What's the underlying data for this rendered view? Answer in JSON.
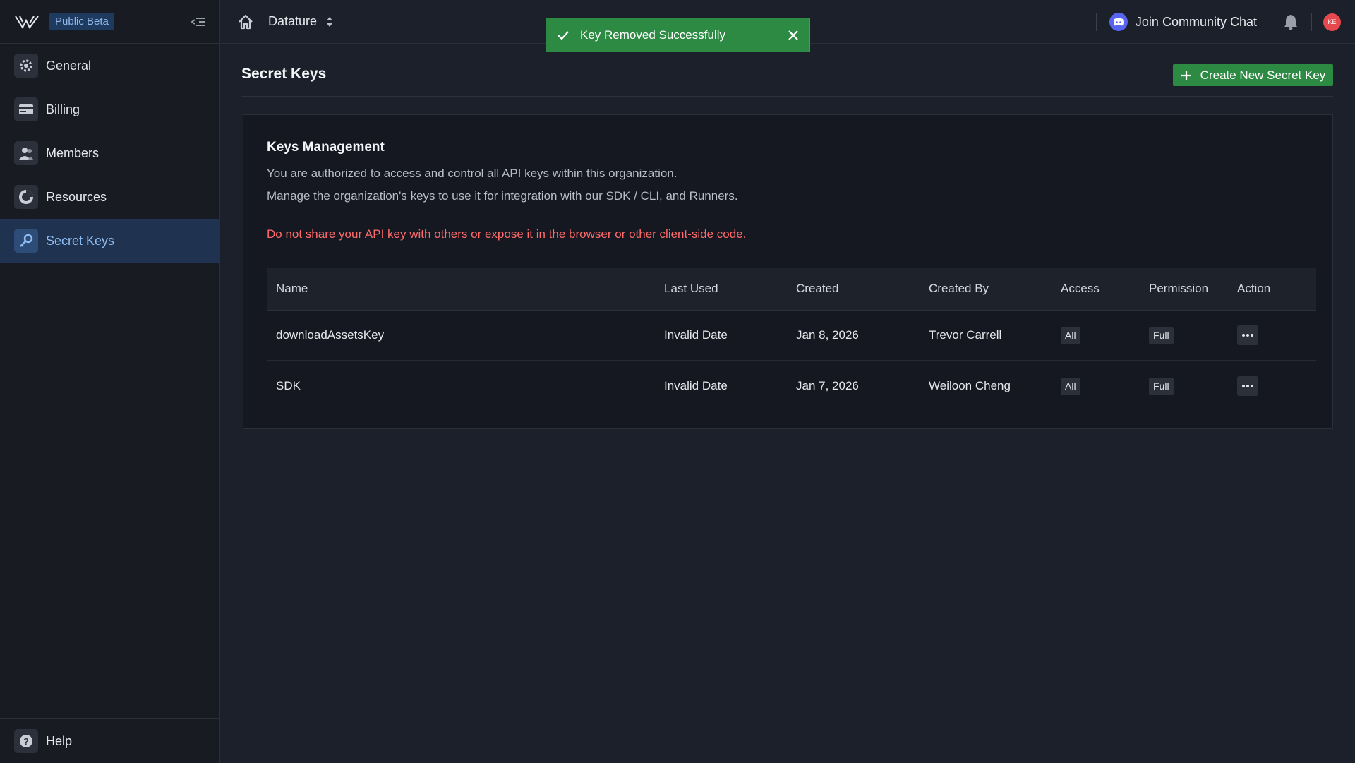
{
  "sidebar": {
    "badge": "Public Beta",
    "items": [
      {
        "label": "General",
        "icon": "gear-icon"
      },
      {
        "label": "Billing",
        "icon": "credit-card-icon"
      },
      {
        "label": "Members",
        "icon": "members-icon"
      },
      {
        "label": "Resources",
        "icon": "resources-icon"
      },
      {
        "label": "Secret Keys",
        "icon": "key-icon",
        "active": true
      }
    ],
    "footer": {
      "label": "Help",
      "icon": "help-icon"
    }
  },
  "topbar": {
    "org_name": "Datature",
    "community_label": "Join Community Chat",
    "avatar_initials": "KE"
  },
  "toast": {
    "message": "Key Removed Successfully"
  },
  "page": {
    "title": "Secret Keys",
    "create_button": "Create New Secret Key"
  },
  "panel": {
    "title": "Keys Management",
    "desc1": "You are authorized to access and control all API keys within this organization.",
    "desc2": "Manage the organization's keys to use it for integration with our SDK / CLI, and Runners.",
    "warning": "Do not share your API key with others or expose it in the browser or other client-side code."
  },
  "table": {
    "headers": {
      "name": "Name",
      "last_used": "Last Used",
      "created": "Created",
      "created_by": "Created By",
      "access": "Access",
      "permission": "Permission",
      "action": "Action"
    },
    "rows": [
      {
        "name": "downloadAssetsKey",
        "last_used": "Invalid Date",
        "created": "Jan 8, 2026",
        "created_by": "Trevor Carrell",
        "access": "All",
        "permission": "Full"
      },
      {
        "name": "SDK",
        "last_used": "Invalid Date",
        "created": "Jan 7, 2026",
        "created_by": "Weiloon Cheng",
        "access": "All",
        "permission": "Full"
      }
    ]
  },
  "colors": {
    "accent_green": "#2d8a43",
    "warning_red": "#ff6b6b",
    "active_blue": "#8fbdf2"
  }
}
